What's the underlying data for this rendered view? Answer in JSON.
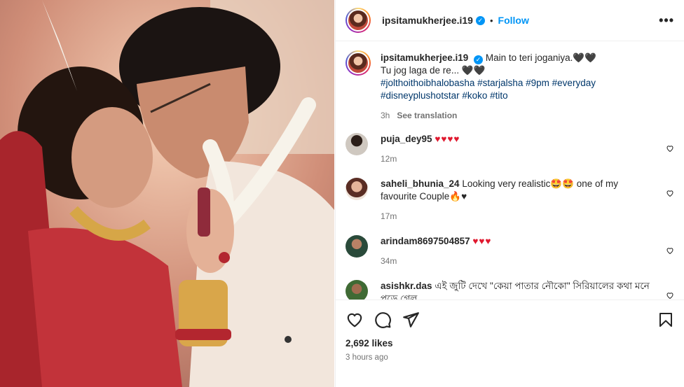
{
  "header": {
    "username": "ipsitamukherjee.i19",
    "separator": "•",
    "follow_label": "Follow",
    "more_label": "•••"
  },
  "caption": {
    "username": "ipsitamukherjee.i19",
    "line1": "Main to teri joganiya.🖤🖤",
    "line2": "Tu jog laga de re... 🖤🖤",
    "hashtags": "#jolthoithoibhalobasha #starjalsha #9pm #everyday #disneyplushotstar #koko #tito",
    "time": "3h",
    "translate_label": "See translation"
  },
  "comments": [
    {
      "username": "puja_dey95",
      "text": "♥♥♥♥",
      "time": "12m"
    },
    {
      "username": "saheli_bhunia_24",
      "text": "Looking very realistic🤩🤩 one of my favourite Couple🔥♥",
      "time": "17m"
    },
    {
      "username": "arindam8697504857",
      "text": "♥♥♥",
      "time": "34m"
    },
    {
      "username": "asishkr.das",
      "text": "এই জুটি দেখে \"কেয়া পাতার নৌকো\" সিরিয়ালের কথা মনে পড়ে গেল",
      "time": ""
    }
  ],
  "footer": {
    "likes": "2,692 likes",
    "ago": "3 hours ago"
  },
  "icons": [
    "heart-icon",
    "comment-icon",
    "share-icon",
    "bookmark-icon",
    "verified-icon",
    "more-icon"
  ],
  "colors": {
    "accent": "#0095f6",
    "link": "#00376b",
    "meta": "#737373",
    "heart": "#e0192f"
  }
}
